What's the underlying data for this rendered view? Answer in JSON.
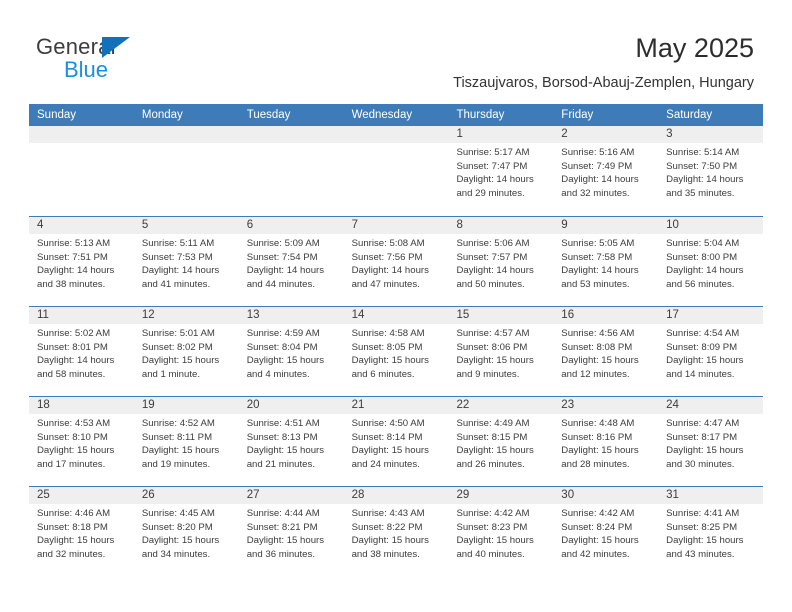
{
  "brand": {
    "name_top": "General",
    "name_bottom": "Blue",
    "accent_color": "#1271bd",
    "blue_text_color": "#1a8fe0"
  },
  "header": {
    "title": "May 2025",
    "subtitle": "Tiszaujvaros, Borsod-Abauj-Zemplen, Hungary"
  },
  "calendar": {
    "header_bg": "#3e7cb9",
    "day_band_bg": "#efefef",
    "weekdays": [
      "Sunday",
      "Monday",
      "Tuesday",
      "Wednesday",
      "Thursday",
      "Friday",
      "Saturday"
    ],
    "weeks": [
      [
        {
          "day": "",
          "empty": true,
          "sunrise": "",
          "sunset": "",
          "daylight1": "",
          "daylight2": ""
        },
        {
          "day": "",
          "empty": true,
          "sunrise": "",
          "sunset": "",
          "daylight1": "",
          "daylight2": ""
        },
        {
          "day": "",
          "empty": true,
          "sunrise": "",
          "sunset": "",
          "daylight1": "",
          "daylight2": ""
        },
        {
          "day": "",
          "empty": true,
          "sunrise": "",
          "sunset": "",
          "daylight1": "",
          "daylight2": ""
        },
        {
          "day": "1",
          "sunrise": "Sunrise: 5:17 AM",
          "sunset": "Sunset: 7:47 PM",
          "daylight1": "Daylight: 14 hours",
          "daylight2": "and 29 minutes."
        },
        {
          "day": "2",
          "sunrise": "Sunrise: 5:16 AM",
          "sunset": "Sunset: 7:49 PM",
          "daylight1": "Daylight: 14 hours",
          "daylight2": "and 32 minutes."
        },
        {
          "day": "3",
          "sunrise": "Sunrise: 5:14 AM",
          "sunset": "Sunset: 7:50 PM",
          "daylight1": "Daylight: 14 hours",
          "daylight2": "and 35 minutes."
        }
      ],
      [
        {
          "day": "4",
          "sunrise": "Sunrise: 5:13 AM",
          "sunset": "Sunset: 7:51 PM",
          "daylight1": "Daylight: 14 hours",
          "daylight2": "and 38 minutes."
        },
        {
          "day": "5",
          "sunrise": "Sunrise: 5:11 AM",
          "sunset": "Sunset: 7:53 PM",
          "daylight1": "Daylight: 14 hours",
          "daylight2": "and 41 minutes."
        },
        {
          "day": "6",
          "sunrise": "Sunrise: 5:09 AM",
          "sunset": "Sunset: 7:54 PM",
          "daylight1": "Daylight: 14 hours",
          "daylight2": "and 44 minutes."
        },
        {
          "day": "7",
          "sunrise": "Sunrise: 5:08 AM",
          "sunset": "Sunset: 7:56 PM",
          "daylight1": "Daylight: 14 hours",
          "daylight2": "and 47 minutes."
        },
        {
          "day": "8",
          "sunrise": "Sunrise: 5:06 AM",
          "sunset": "Sunset: 7:57 PM",
          "daylight1": "Daylight: 14 hours",
          "daylight2": "and 50 minutes."
        },
        {
          "day": "9",
          "sunrise": "Sunrise: 5:05 AM",
          "sunset": "Sunset: 7:58 PM",
          "daylight1": "Daylight: 14 hours",
          "daylight2": "and 53 minutes."
        },
        {
          "day": "10",
          "sunrise": "Sunrise: 5:04 AM",
          "sunset": "Sunset: 8:00 PM",
          "daylight1": "Daylight: 14 hours",
          "daylight2": "and 56 minutes."
        }
      ],
      [
        {
          "day": "11",
          "sunrise": "Sunrise: 5:02 AM",
          "sunset": "Sunset: 8:01 PM",
          "daylight1": "Daylight: 14 hours",
          "daylight2": "and 58 minutes."
        },
        {
          "day": "12",
          "sunrise": "Sunrise: 5:01 AM",
          "sunset": "Sunset: 8:02 PM",
          "daylight1": "Daylight: 15 hours",
          "daylight2": "and 1 minute."
        },
        {
          "day": "13",
          "sunrise": "Sunrise: 4:59 AM",
          "sunset": "Sunset: 8:04 PM",
          "daylight1": "Daylight: 15 hours",
          "daylight2": "and 4 minutes."
        },
        {
          "day": "14",
          "sunrise": "Sunrise: 4:58 AM",
          "sunset": "Sunset: 8:05 PM",
          "daylight1": "Daylight: 15 hours",
          "daylight2": "and 6 minutes."
        },
        {
          "day": "15",
          "sunrise": "Sunrise: 4:57 AM",
          "sunset": "Sunset: 8:06 PM",
          "daylight1": "Daylight: 15 hours",
          "daylight2": "and 9 minutes."
        },
        {
          "day": "16",
          "sunrise": "Sunrise: 4:56 AM",
          "sunset": "Sunset: 8:08 PM",
          "daylight1": "Daylight: 15 hours",
          "daylight2": "and 12 minutes."
        },
        {
          "day": "17",
          "sunrise": "Sunrise: 4:54 AM",
          "sunset": "Sunset: 8:09 PM",
          "daylight1": "Daylight: 15 hours",
          "daylight2": "and 14 minutes."
        }
      ],
      [
        {
          "day": "18",
          "sunrise": "Sunrise: 4:53 AM",
          "sunset": "Sunset: 8:10 PM",
          "daylight1": "Daylight: 15 hours",
          "daylight2": "and 17 minutes."
        },
        {
          "day": "19",
          "sunrise": "Sunrise: 4:52 AM",
          "sunset": "Sunset: 8:11 PM",
          "daylight1": "Daylight: 15 hours",
          "daylight2": "and 19 minutes."
        },
        {
          "day": "20",
          "sunrise": "Sunrise: 4:51 AM",
          "sunset": "Sunset: 8:13 PM",
          "daylight1": "Daylight: 15 hours",
          "daylight2": "and 21 minutes."
        },
        {
          "day": "21",
          "sunrise": "Sunrise: 4:50 AM",
          "sunset": "Sunset: 8:14 PM",
          "daylight1": "Daylight: 15 hours",
          "daylight2": "and 24 minutes."
        },
        {
          "day": "22",
          "sunrise": "Sunrise: 4:49 AM",
          "sunset": "Sunset: 8:15 PM",
          "daylight1": "Daylight: 15 hours",
          "daylight2": "and 26 minutes."
        },
        {
          "day": "23",
          "sunrise": "Sunrise: 4:48 AM",
          "sunset": "Sunset: 8:16 PM",
          "daylight1": "Daylight: 15 hours",
          "daylight2": "and 28 minutes."
        },
        {
          "day": "24",
          "sunrise": "Sunrise: 4:47 AM",
          "sunset": "Sunset: 8:17 PM",
          "daylight1": "Daylight: 15 hours",
          "daylight2": "and 30 minutes."
        }
      ],
      [
        {
          "day": "25",
          "sunrise": "Sunrise: 4:46 AM",
          "sunset": "Sunset: 8:18 PM",
          "daylight1": "Daylight: 15 hours",
          "daylight2": "and 32 minutes."
        },
        {
          "day": "26",
          "sunrise": "Sunrise: 4:45 AM",
          "sunset": "Sunset: 8:20 PM",
          "daylight1": "Daylight: 15 hours",
          "daylight2": "and 34 minutes."
        },
        {
          "day": "27",
          "sunrise": "Sunrise: 4:44 AM",
          "sunset": "Sunset: 8:21 PM",
          "daylight1": "Daylight: 15 hours",
          "daylight2": "and 36 minutes."
        },
        {
          "day": "28",
          "sunrise": "Sunrise: 4:43 AM",
          "sunset": "Sunset: 8:22 PM",
          "daylight1": "Daylight: 15 hours",
          "daylight2": "and 38 minutes."
        },
        {
          "day": "29",
          "sunrise": "Sunrise: 4:42 AM",
          "sunset": "Sunset: 8:23 PM",
          "daylight1": "Daylight: 15 hours",
          "daylight2": "and 40 minutes."
        },
        {
          "day": "30",
          "sunrise": "Sunrise: 4:42 AM",
          "sunset": "Sunset: 8:24 PM",
          "daylight1": "Daylight: 15 hours",
          "daylight2": "and 42 minutes."
        },
        {
          "day": "31",
          "sunrise": "Sunrise: 4:41 AM",
          "sunset": "Sunset: 8:25 PM",
          "daylight1": "Daylight: 15 hours",
          "daylight2": "and 43 minutes."
        }
      ]
    ]
  }
}
